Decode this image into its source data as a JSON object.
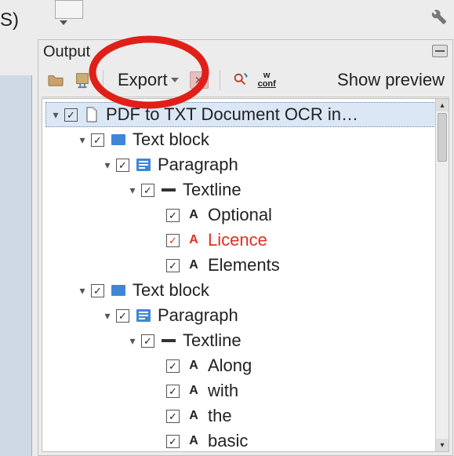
{
  "top": {
    "paren_label": "S)"
  },
  "panel": {
    "title": "Output"
  },
  "toolbar": {
    "export_label": "Export",
    "wconf_top": "w",
    "wconf_bottom": "conf",
    "show_preview": "Show preview"
  },
  "tree": {
    "root": {
      "label": "PDF to TXT Document OCR in…",
      "checked": true,
      "children": [
        {
          "label": "Text block",
          "checked": true,
          "children": [
            {
              "label": "Paragraph",
              "checked": true,
              "children": [
                {
                  "label": "Textline",
                  "checked": true,
                  "children": [
                    {
                      "label": "Optional",
                      "checked": true
                    },
                    {
                      "label": "Licence",
                      "checked": true,
                      "highlight": true
                    },
                    {
                      "label": "Elements",
                      "checked": true
                    }
                  ]
                }
              ]
            }
          ]
        },
        {
          "label": "Text block",
          "checked": true,
          "children": [
            {
              "label": "Paragraph",
              "checked": true,
              "children": [
                {
                  "label": "Textline",
                  "checked": true,
                  "children": [
                    {
                      "label": "Along",
                      "checked": true
                    },
                    {
                      "label": "with",
                      "checked": true
                    },
                    {
                      "label": "the",
                      "checked": true
                    },
                    {
                      "label": "basic",
                      "checked": true
                    }
                  ]
                }
              ]
            }
          ]
        }
      ]
    }
  }
}
